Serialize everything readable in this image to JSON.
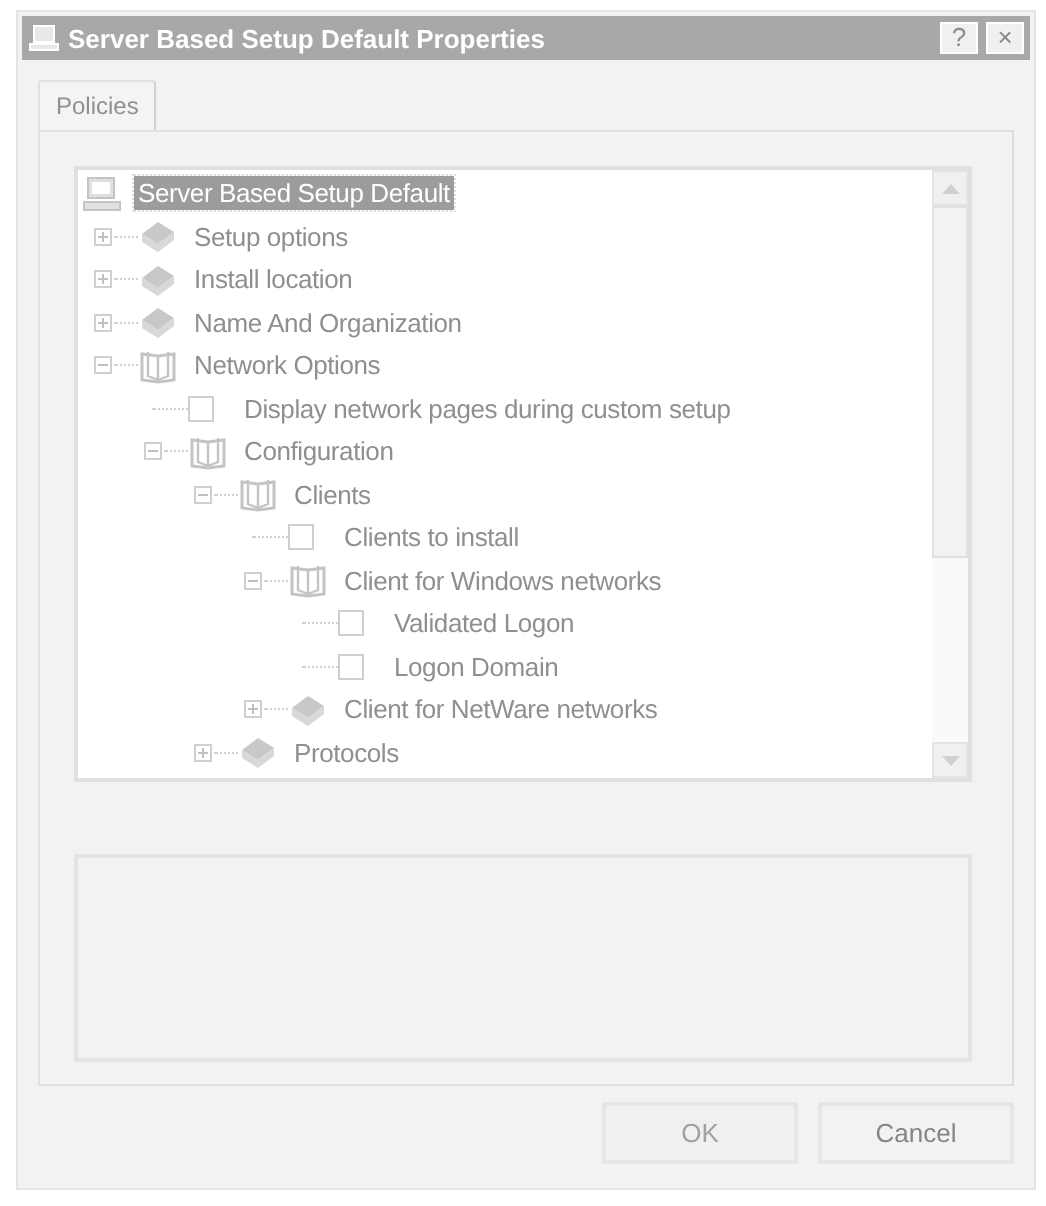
{
  "window": {
    "title": "Server Based Setup Default Properties",
    "help_button": "?",
    "close_button": "×"
  },
  "tabs": [
    {
      "label": "Policies",
      "selected": true
    }
  ],
  "tree": {
    "label": "Server Based Setup Default",
    "kind": "computer",
    "selected": true,
    "children": [
      {
        "label": "Setup options",
        "kind": "category",
        "expanded": false
      },
      {
        "label": "Install location",
        "kind": "category",
        "expanded": false
      },
      {
        "label": "Name And Organization",
        "kind": "category",
        "expanded": false
      },
      {
        "label": "Network Options",
        "kind": "category",
        "expanded": true,
        "children": [
          {
            "label": "Display network pages during custom setup",
            "kind": "policy",
            "checked": false
          },
          {
            "label": "Configuration",
            "kind": "category",
            "expanded": true,
            "children": [
              {
                "label": "Clients",
                "kind": "category",
                "expanded": true,
                "children": [
                  {
                    "label": "Clients to install",
                    "kind": "policy",
                    "checked": false
                  },
                  {
                    "label": "Client for Windows networks",
                    "kind": "category",
                    "expanded": true,
                    "children": [
                      {
                        "label": "Validated Logon",
                        "kind": "policy",
                        "checked": false
                      },
                      {
                        "label": "Logon Domain",
                        "kind": "policy",
                        "checked": false
                      }
                    ]
                  },
                  {
                    "label": "Client for NetWare networks",
                    "kind": "category",
                    "expanded": false
                  }
                ]
              },
              {
                "label": "Protocols",
                "kind": "category",
                "expanded": false
              }
            ]
          }
        ]
      }
    ]
  },
  "buttons": [
    {
      "label": "OK",
      "disabled": true
    },
    {
      "label": "Cancel",
      "disabled": false
    }
  ]
}
